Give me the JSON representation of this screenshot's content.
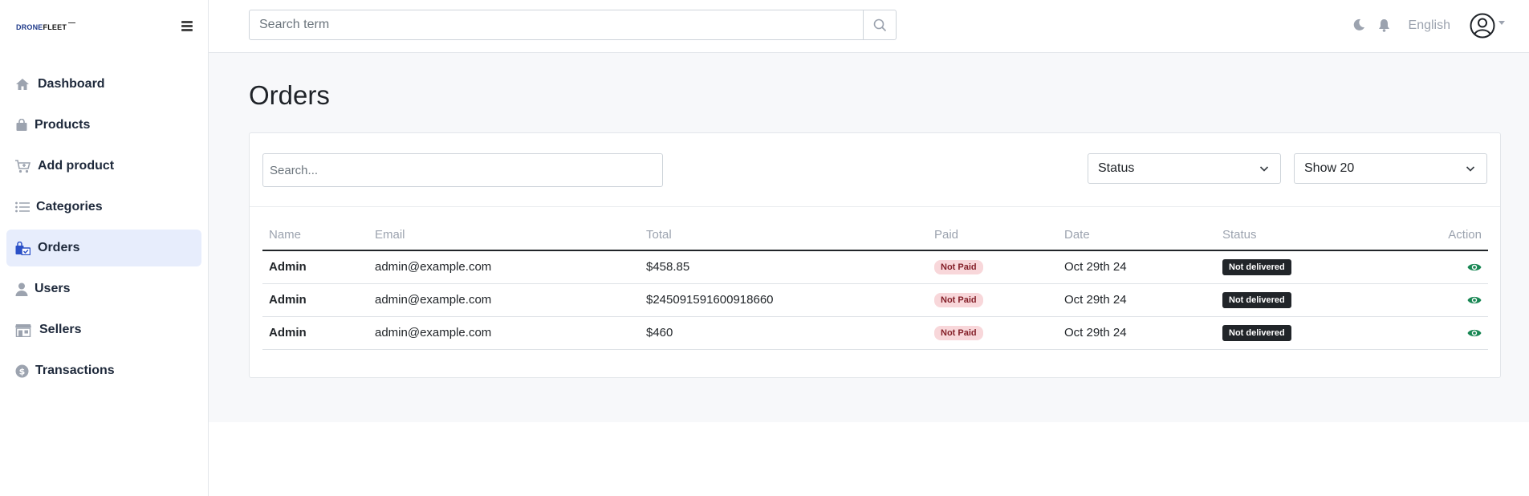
{
  "brand": {
    "logo_part1": "DRONE",
    "logo_part2": "FLEET"
  },
  "sidebar": {
    "items": [
      {
        "label": "Dashboard",
        "icon": "home-icon",
        "active": false
      },
      {
        "label": "Products",
        "icon": "shopping-bag-icon",
        "active": false
      },
      {
        "label": "Add product",
        "icon": "cart-plus-icon",
        "active": false
      },
      {
        "label": "Categories",
        "icon": "list-icon",
        "active": false
      },
      {
        "label": "Orders",
        "icon": "bag-check-icon",
        "active": true
      },
      {
        "label": "Users",
        "icon": "user-icon",
        "active": false
      },
      {
        "label": "Sellers",
        "icon": "store-icon",
        "active": false
      },
      {
        "label": "Transactions",
        "icon": "dollar-circle-icon",
        "active": false
      }
    ]
  },
  "topbar": {
    "search_placeholder": "Search term",
    "language": "English"
  },
  "main": {
    "title": "Orders",
    "search_placeholder": "Search...",
    "status_select": "Status",
    "show_select": "Show 20",
    "columns": [
      "Name",
      "Email",
      "Total",
      "Paid",
      "Date",
      "Status",
      "Action"
    ],
    "rows": [
      {
        "name": "Admin",
        "email": "admin@example.com",
        "total": "$458.85",
        "paid": "Not Paid",
        "date": "Oct 29th 24",
        "status": "Not delivered"
      },
      {
        "name": "Admin",
        "email": "admin@example.com",
        "total": "$245091591600918660",
        "paid": "Not Paid",
        "date": "Oct 29th 24",
        "status": "Not delivered"
      },
      {
        "name": "Admin",
        "email": "admin@example.com",
        "total": "$460",
        "paid": "Not Paid",
        "date": "Oct 29th 24",
        "status": "Not delivered"
      }
    ]
  },
  "colors": {
    "active_nav_bg": "#e7edfc",
    "active_nav_icon": "#2b50c7",
    "eye_icon": "#198754",
    "paid_badge_bg": "#f8d7da",
    "status_badge_bg": "#212529"
  }
}
